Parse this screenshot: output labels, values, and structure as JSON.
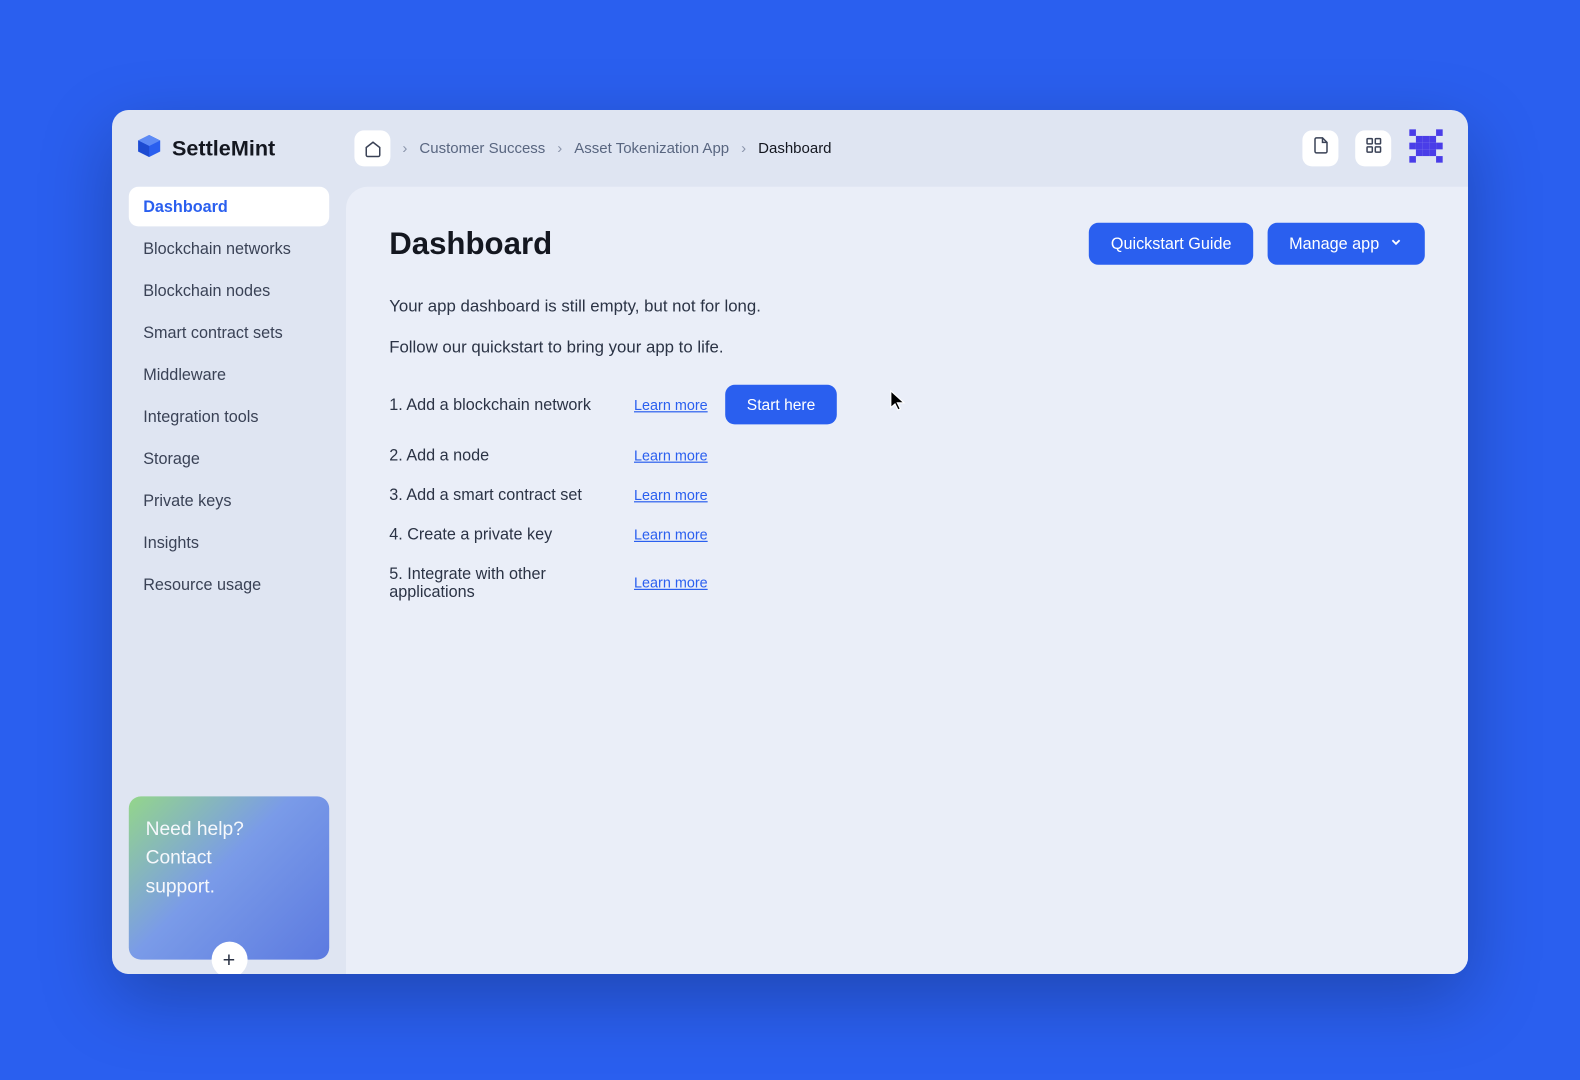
{
  "brand": {
    "name": "SettleMint"
  },
  "breadcrumb": {
    "items": [
      {
        "label": "Customer Success"
      },
      {
        "label": "Asset Tokenization App"
      },
      {
        "label": "Dashboard"
      }
    ]
  },
  "sidebar": {
    "items": [
      {
        "label": "Dashboard",
        "active": true
      },
      {
        "label": "Blockchain networks",
        "active": false
      },
      {
        "label": "Blockchain nodes",
        "active": false
      },
      {
        "label": "Smart contract sets",
        "active": false
      },
      {
        "label": "Middleware",
        "active": false
      },
      {
        "label": "Integration tools",
        "active": false
      },
      {
        "label": "Storage",
        "active": false
      },
      {
        "label": "Private keys",
        "active": false
      },
      {
        "label": "Insights",
        "active": false
      },
      {
        "label": "Resource usage",
        "active": false
      }
    ],
    "help_card": {
      "line1": "Need help?",
      "line2": "Contact",
      "line3": "support."
    }
  },
  "main": {
    "title": "Dashboard",
    "actions": {
      "quickstart": "Quickstart Guide",
      "manage": "Manage app"
    },
    "empty_line1": "Your app dashboard is still empty, but not for long.",
    "empty_line2": "Follow our quickstart to bring your app to life.",
    "learn_more_label": "Learn more",
    "start_here_label": "Start here",
    "steps": [
      {
        "label": "1. Add a blockchain network",
        "has_start": true
      },
      {
        "label": "2. Add a node",
        "has_start": false
      },
      {
        "label": "3. Add a smart contract set",
        "has_start": false
      },
      {
        "label": "4. Create a private key",
        "has_start": false
      },
      {
        "label": "5. Integrate with other applications",
        "has_start": false
      }
    ]
  }
}
